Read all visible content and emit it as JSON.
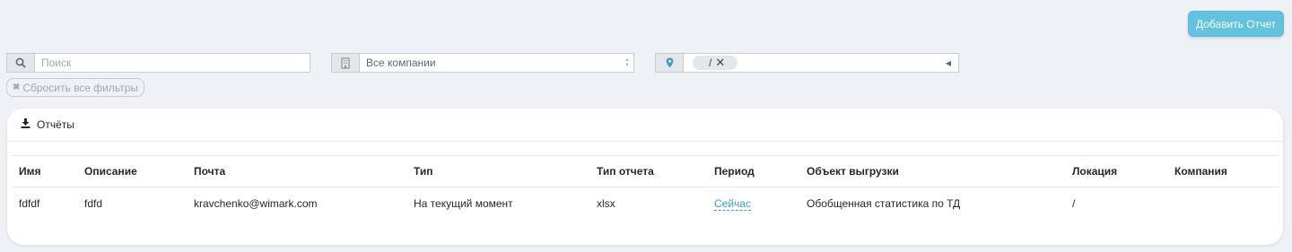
{
  "toolbar": {
    "add_report_label": "Добавить Отчет"
  },
  "filters": {
    "search_placeholder": "Поиск",
    "companies_value": "Все компании",
    "location_tag": "/",
    "reset_label": "Сбросить все фильтры"
  },
  "card": {
    "title": "Отчёты"
  },
  "table": {
    "columns": [
      "Имя",
      "Описание",
      "Почта",
      "Тип",
      "Тип отчета",
      "Период",
      "Объект выгрузки",
      "Локация",
      "Компания"
    ],
    "rows": [
      [
        "fdfdf",
        "fdfd",
        "kravchenko@wimark.com",
        "На текущий момент",
        "xlsx",
        "Сейчас",
        "Обобщенная статистика по ТД",
        "/",
        ""
      ]
    ]
  },
  "colors": {
    "accent": "#63c2de",
    "link": "#3a9ec9",
    "background": "#eef1f5"
  },
  "icons": [
    "search-icon",
    "building-icon",
    "map-marker-icon",
    "close-icon",
    "download-icon"
  ]
}
